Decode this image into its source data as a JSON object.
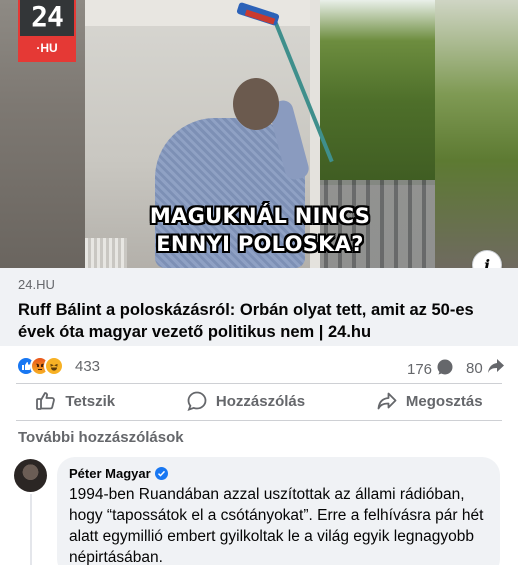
{
  "preview": {
    "logo_number": "24",
    "logo_suffix": "·HU",
    "caption_line1": "MAGUKNÁL NINCS",
    "caption_line2": "ENNYI POLOSKA?",
    "info_glyph": "i"
  },
  "link": {
    "domain": "24.HU",
    "headline": "Ruff Bálint a poloskázásról: Orbán olyat tett, amit az 50-es évek óta magyar vezető politikus nem | 24.hu"
  },
  "reactions": {
    "icons": [
      "like-icon",
      "angry-icon",
      "haha-icon"
    ],
    "count": "433",
    "comments": "176",
    "shares": "80"
  },
  "actions": {
    "like_label": "Tetszik",
    "comment_label": "Hozzászólás",
    "share_label": "Megosztás"
  },
  "comments": {
    "more_label": "További hozzászólások",
    "items": [
      {
        "author": "Péter Magyar",
        "verified": true,
        "text": "1994-ben Ruandában azzal uszítottak az állami rádióban, hogy “tapossátok el a csótányokat”. Erre a felhívásra pár hét alatt egymillió embert gyilkoltak le a világ egyik legnagyobb népirtásában."
      }
    ]
  },
  "colors": {
    "accent_blue": "#1877f2",
    "muted_text": "#65676b",
    "link_bg": "#f0f2f5",
    "logo_red": "#e53935"
  }
}
